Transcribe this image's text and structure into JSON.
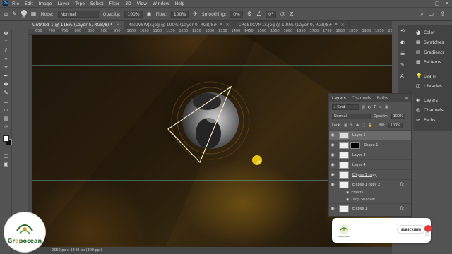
{
  "app": {
    "logo_text": "Ps"
  },
  "menu": [
    "File",
    "Edit",
    "Image",
    "Layer",
    "Type",
    "Select",
    "Filter",
    "3D",
    "View",
    "Window",
    "Help"
  ],
  "options": {
    "brush_size": "80",
    "mode_label": "Mode:",
    "mode_value": "Normal",
    "opacity_label": "Opacity:",
    "opacity_value": "100%",
    "flow_label": "Flow:",
    "flow_value": "100%",
    "smoothing_label": "Smoothing:",
    "smoothing_value": "0%",
    "angle_value": "0°"
  },
  "tabs": [
    {
      "label": "Untitled-1 @ 116% (Layer 5, RGB/8) *",
      "close": "×"
    },
    {
      "label": "4lkUVSWJx.jpg @ 100% (Layer 0, RGB/8#) *",
      "close": "×"
    },
    {
      "label": "CRgEkCVM1x.jpg @ 100% (Layer 0, RGB/8#) *",
      "close": "×"
    }
  ],
  "ruler": [
    "650",
    "700",
    "750",
    "800",
    "850",
    "900",
    "950",
    "1000",
    "1050",
    "1100",
    "1150",
    "1200",
    "1250",
    "1300",
    "1350",
    "1400",
    "1450",
    "1500",
    "1550",
    "1600",
    "1650",
    "1700",
    "1750",
    "1800",
    "1850",
    "1900",
    "1950",
    "2000"
  ],
  "status": "2560 px x 1440 px (300 ppi)",
  "right_panels": {
    "group1": [
      "Color",
      "Swatches",
      "Gradients",
      "Patterns"
    ],
    "group2": [
      "Learn",
      "Libraries"
    ],
    "group3": [
      "Layers",
      "Channels",
      "Paths"
    ]
  },
  "layers_panel": {
    "tabs": [
      "Layers",
      "Channels",
      "Paths"
    ],
    "kind_label": "Kind",
    "blend_mode": "Normal",
    "opacity_label": "Opacity:",
    "opacity_value": "100%",
    "lock_label": "Lock:",
    "fill_label": "Fill:",
    "fill_value": "100%",
    "layers": [
      {
        "name": "Layer 5",
        "selected": true
      },
      {
        "name": "Shape 1",
        "mask": true
      },
      {
        "name": "Layer 3"
      },
      {
        "name": "Layer 4"
      },
      {
        "name": "Ellipse 1 copy"
      },
      {
        "name": "Ellipse 1 copy 2",
        "fx": "fx"
      },
      {
        "name": "Ellipse 1",
        "fx": "fx"
      }
    ],
    "effects_label": "Effects",
    "drop_shadow_label": "Drop Shadow"
  },
  "subscribe": {
    "button": "SUBSCRIBED",
    "logo_text": "Grapocean"
  },
  "brand": {
    "name_pre": "Gr",
    "name_o": "a",
    "name_post": "pocean"
  },
  "colors": {
    "guide": "#7fd3d6",
    "triangle": "#f2e6c4",
    "cursor": "#e8c20d"
  }
}
